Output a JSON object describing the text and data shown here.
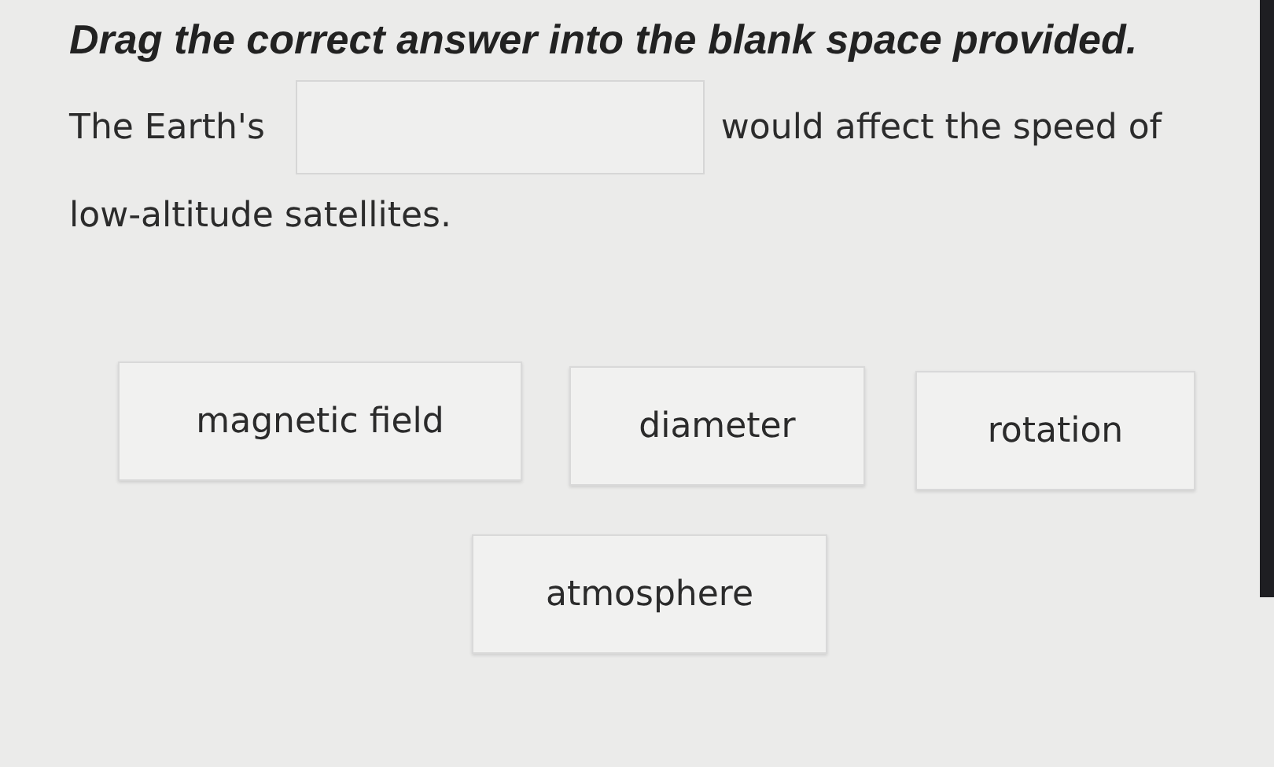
{
  "title": "Drag the correct answer into the blank space provided.",
  "prompt": {
    "before": "The Earth's",
    "after": "would affect the speed of",
    "continuation": "low-altitude satellites."
  },
  "options": [
    {
      "label": "magnetic field"
    },
    {
      "label": "diameter"
    },
    {
      "label": "rotation"
    },
    {
      "label": "atmosphere"
    }
  ]
}
